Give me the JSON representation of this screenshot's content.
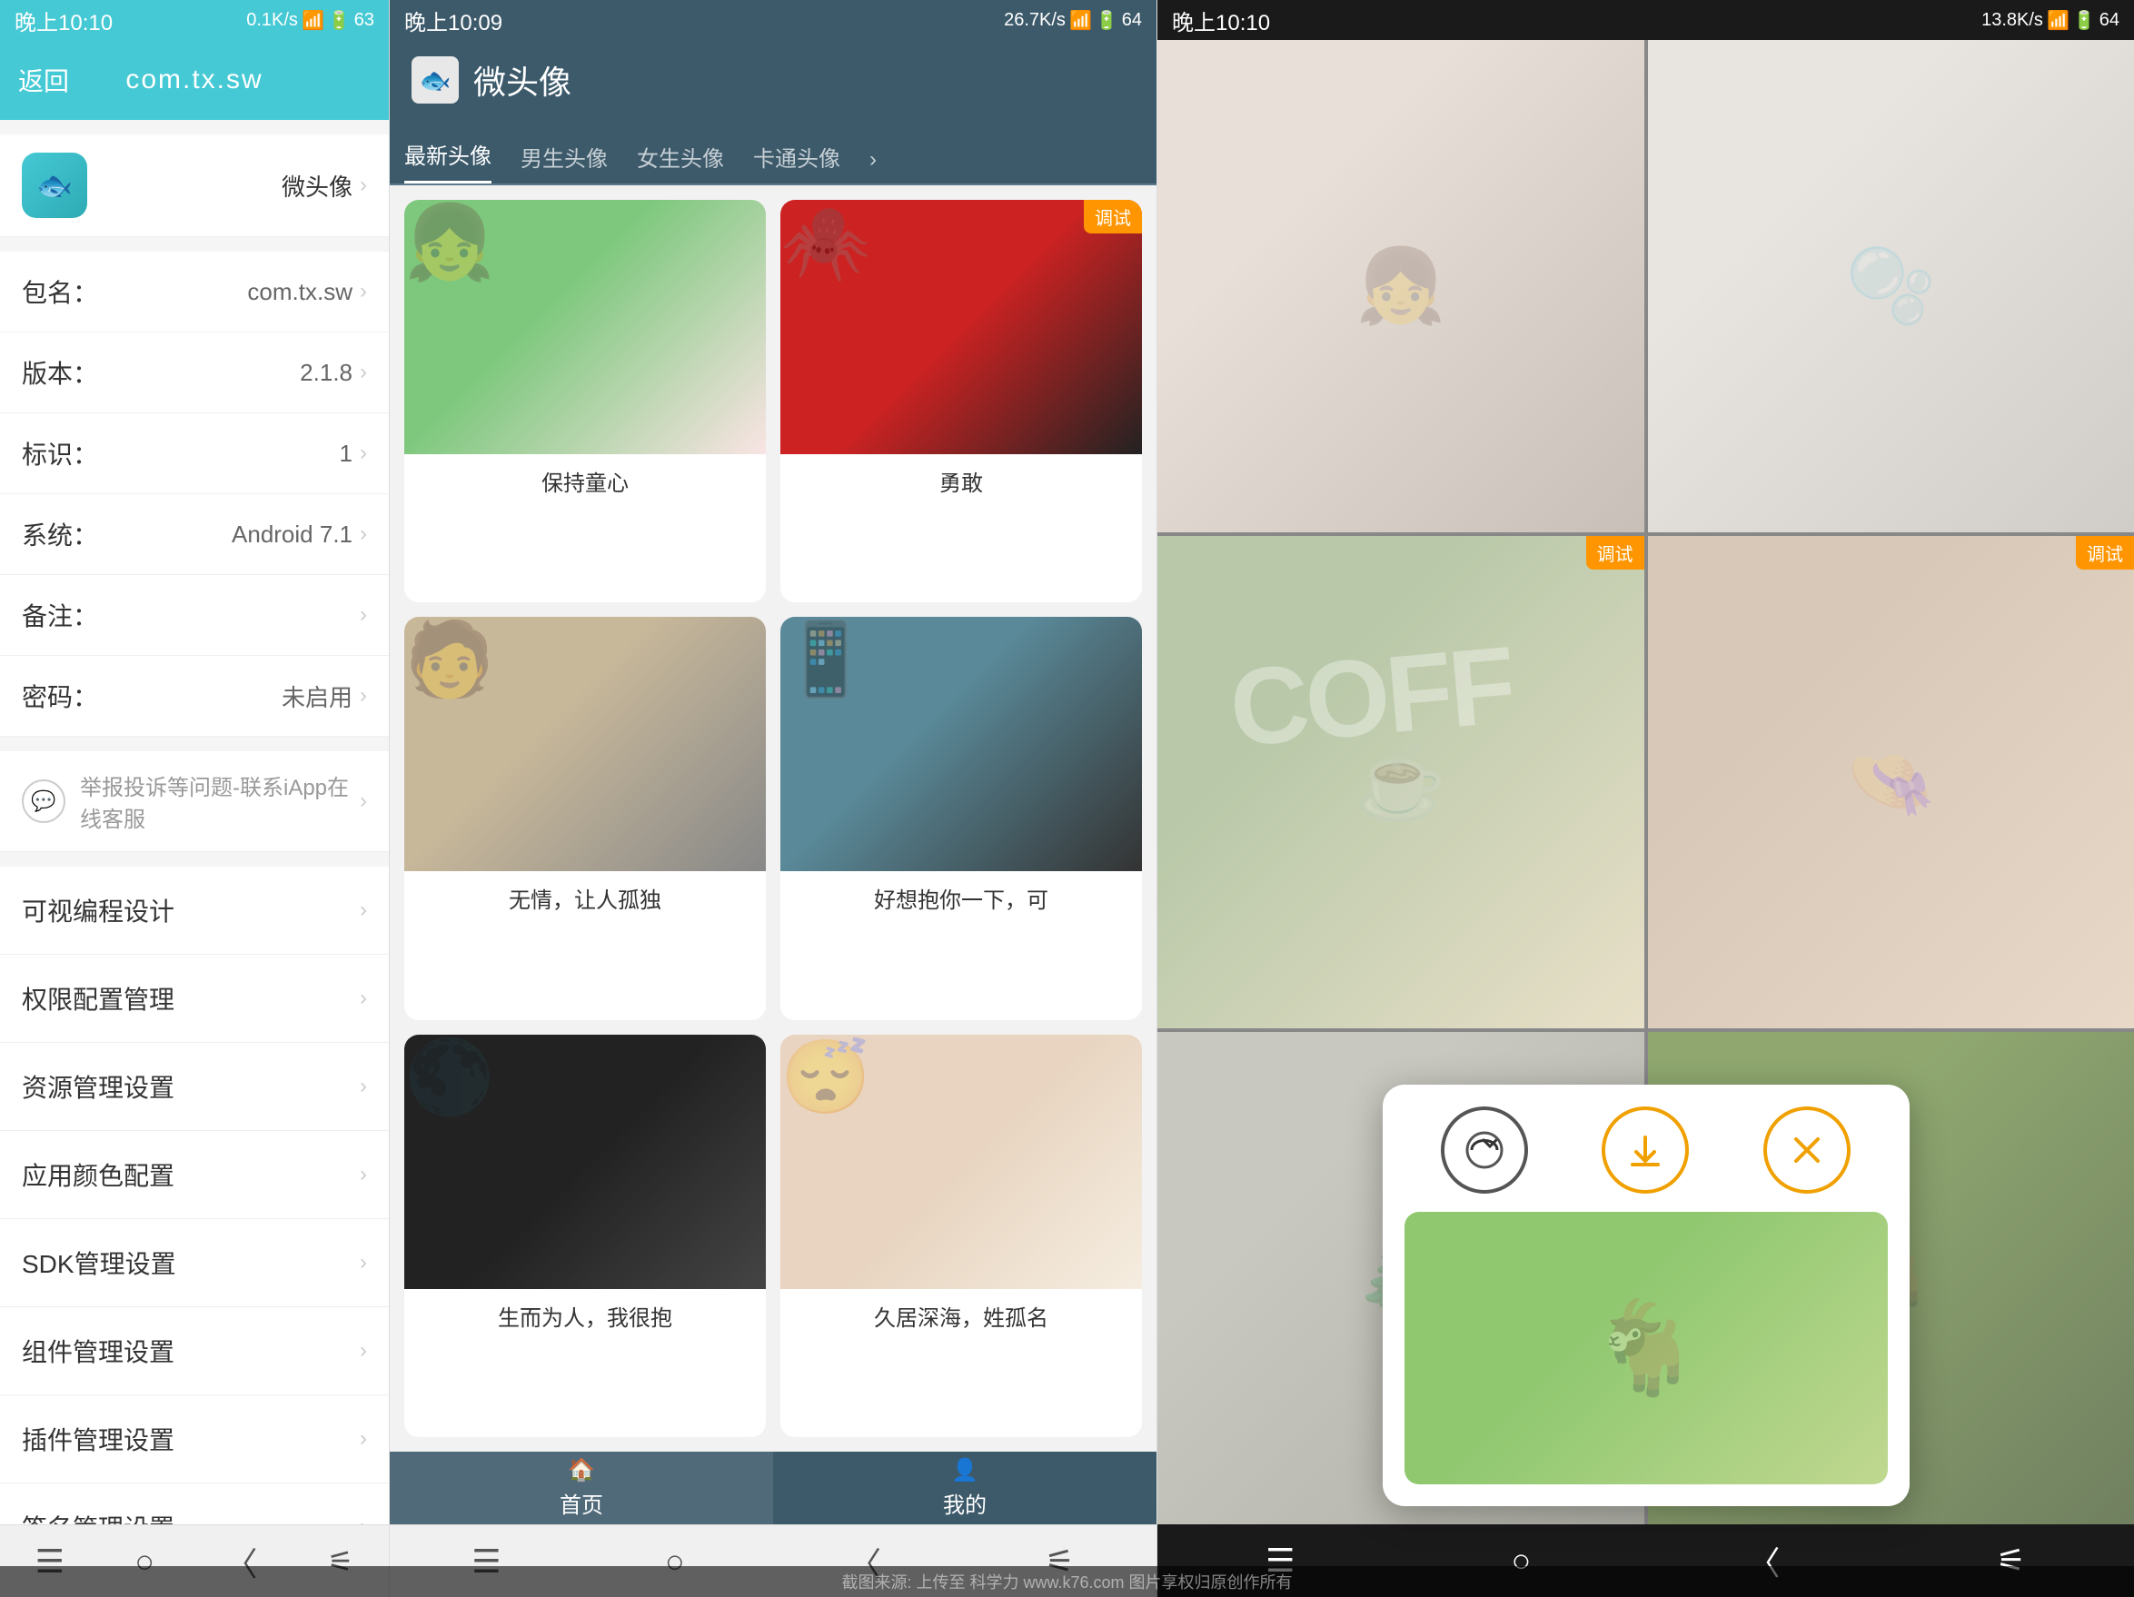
{
  "panel1": {
    "status_time": "晚上10:10",
    "signal": "0.1K/s",
    "battery": "63",
    "back_label": "返回",
    "title": "com.tx.sw",
    "app_icon": "🐟",
    "app_name": "微头像",
    "fields": [
      {
        "label": "包名：",
        "value": "com.tx.sw"
      },
      {
        "label": "版本：",
        "value": "2.1.8"
      },
      {
        "label": "标识：",
        "value": "1"
      },
      {
        "label": "系统：",
        "value": "Android 7.1"
      },
      {
        "label": "备注：",
        "value": ""
      },
      {
        "label": "密码：",
        "value": "未启用"
      }
    ],
    "report_text": "举报投诉等问题-联系iApp在线客服",
    "menu_items": [
      "可视编程设计",
      "权限配置管理",
      "资源管理设置",
      "应用颜色配置",
      "SDK管理设置",
      "组件管理设置",
      "插件管理设置",
      "签名管理设置"
    ]
  },
  "panel2": {
    "status_time": "晚上10:09",
    "signal": "26.7K/s",
    "battery": "64",
    "header_title": "微头像",
    "tabs": [
      {
        "label": "最新头像",
        "active": true
      },
      {
        "label": "男生头像",
        "active": false
      },
      {
        "label": "女生头像",
        "active": false
      },
      {
        "label": "卡通头像",
        "active": false
      }
    ],
    "grid_items": [
      {
        "caption": "保持童心",
        "bg": "girl-fish",
        "debug": false
      },
      {
        "caption": "勇敢",
        "bg": "spiderman",
        "debug": true
      },
      {
        "caption": "无情，让人孤独",
        "bg": "boy-sitting",
        "debug": false
      },
      {
        "caption": "好想抱你一下，可",
        "bg": "boy-phone",
        "debug": false
      },
      {
        "caption": "生而为人，我很抱",
        "bg": "dark-figure",
        "debug": false
      },
      {
        "caption": "久居深海，姓孤名",
        "bg": "girl-sleep",
        "debug": false
      }
    ],
    "bottom_tabs": [
      {
        "label": "首页",
        "active": true,
        "icon": "🏠"
      },
      {
        "label": "我的",
        "active": false,
        "icon": "👤"
      }
    ]
  },
  "panel3": {
    "status_time": "晚上10:10",
    "signal": "13.8K/s",
    "battery": "64",
    "coff_text": "COFF",
    "grid_cells": [
      {
        "bg": "p3-img-1",
        "debug": false
      },
      {
        "bg": "p3-img-2",
        "debug": false
      },
      {
        "bg": "p3-img-3",
        "debug": true,
        "coff": true
      },
      {
        "bg": "p3-img-4",
        "debug": true
      },
      {
        "bg": "p3-img-5",
        "debug": false
      },
      {
        "bg": "p3-img-6",
        "debug": false
      }
    ],
    "popup": {
      "share_icon": "↗",
      "download_icon": "⬇",
      "close_icon": "✕"
    }
  },
  "watermark": "截图来源: 上传至 科学力 www.k76.com 图片享权归原创作所有",
  "nav_icons": {
    "menu": "☰",
    "home": "○",
    "back": "〈",
    "person": "⚟"
  }
}
